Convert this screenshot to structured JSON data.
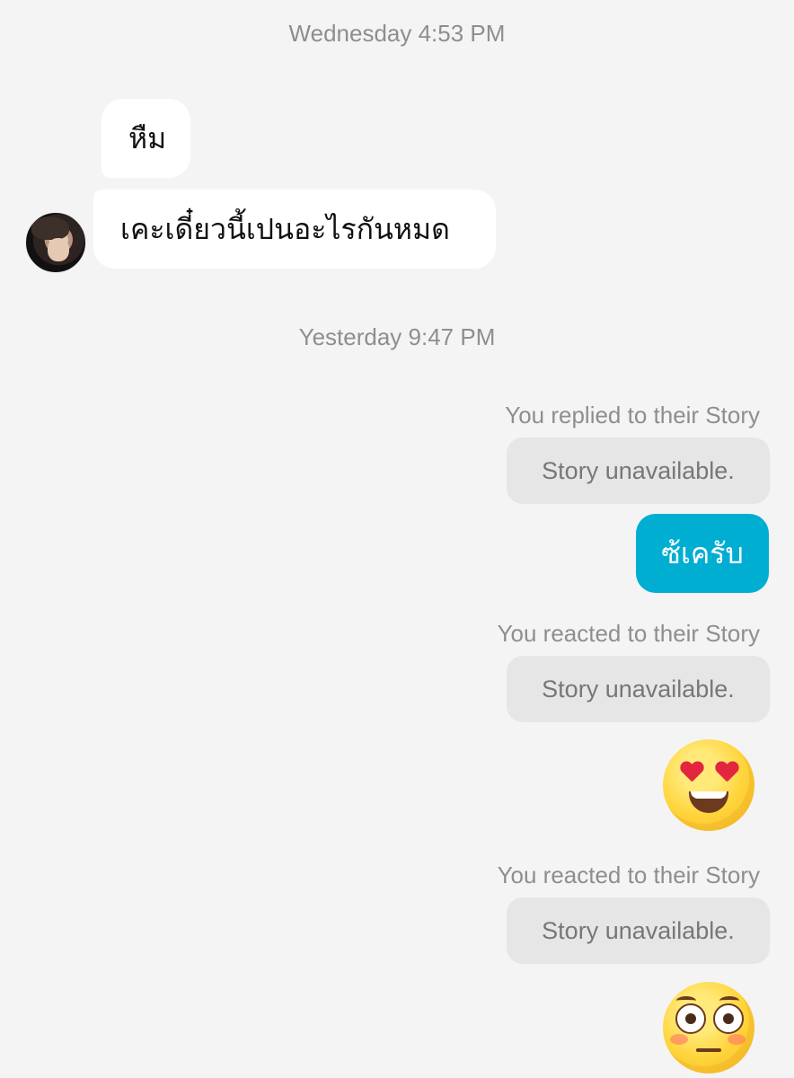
{
  "timestamps": {
    "first": "Wednesday 4:53 PM",
    "second": "Yesterday 9:47 PM"
  },
  "incoming_messages": [
    {
      "text": "หืม"
    },
    {
      "text": "เคะเดี๋ยวนี้เปนอะไรกันหมด"
    }
  ],
  "story_events": [
    {
      "note": "You replied to their Story",
      "box": "Story unavailable."
    },
    {
      "note": "You reacted to their Story",
      "box": "Story unavailable."
    },
    {
      "note": "You reacted to their Story",
      "box": "Story unavailable."
    }
  ],
  "outgoing_messages": [
    {
      "text": "ซ้เครับ"
    }
  ],
  "reactions": [
    {
      "icon": "heart-eyes-emoji-icon"
    },
    {
      "icon": "flushed-face-emoji-icon"
    }
  ],
  "colors": {
    "background": "#f4f4f4",
    "incoming_bubble": "#ffffff",
    "outgoing_bubble": "#00aed2",
    "story_bubble": "#e6e6e6",
    "muted_text": "#8e8e8e"
  }
}
